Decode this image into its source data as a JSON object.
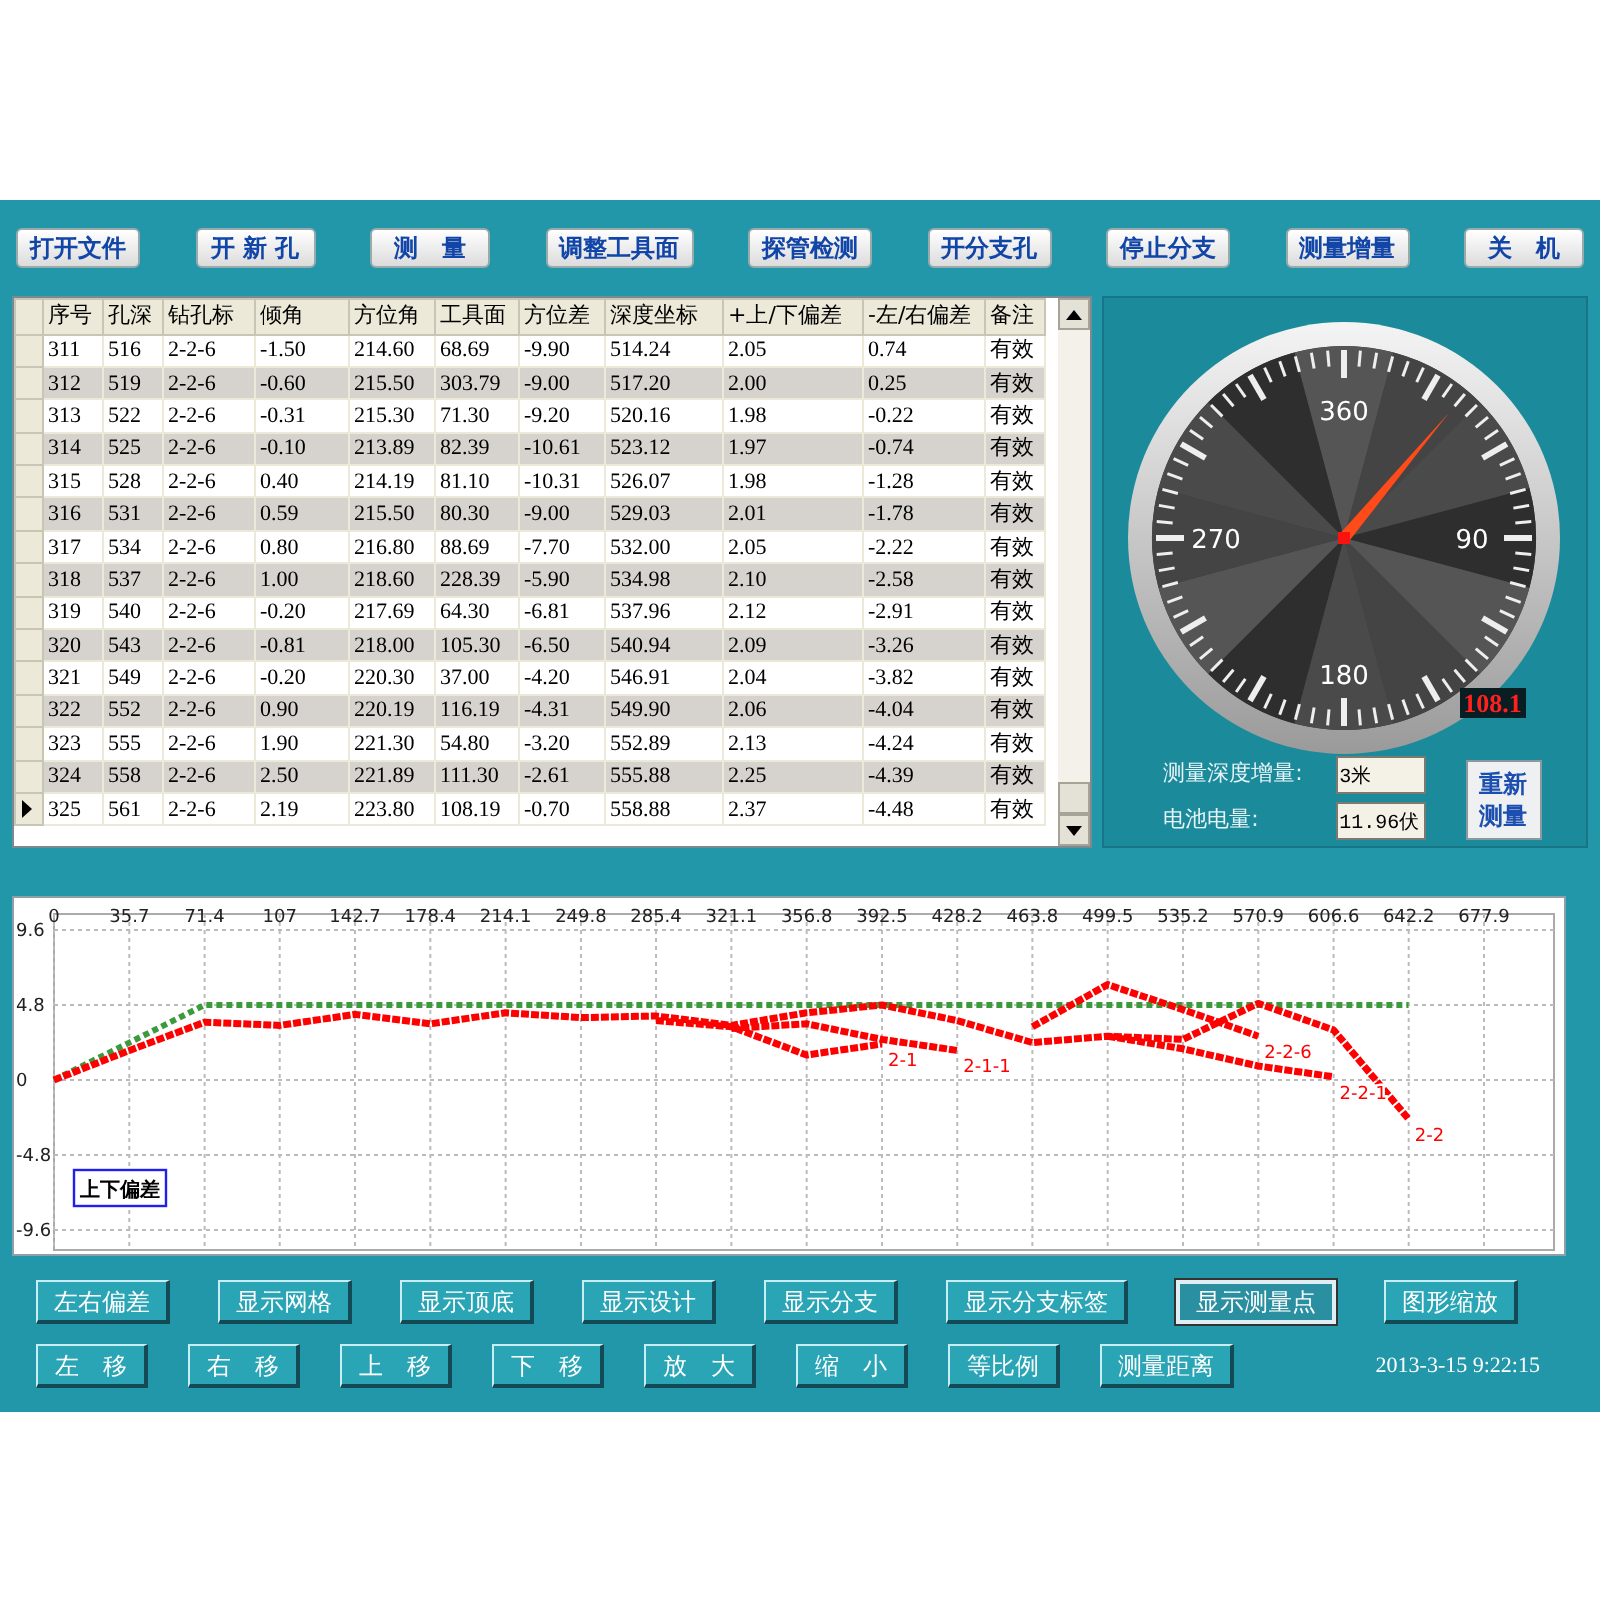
{
  "toolbar": [
    {
      "label": "打开文件"
    },
    {
      "label": "开 新 孔"
    },
    {
      "label": "测　量"
    },
    {
      "label": "调整工具面"
    },
    {
      "label": "探管检测"
    },
    {
      "label": "开分支孔"
    },
    {
      "label": "停止分支"
    },
    {
      "label": "测量增量"
    },
    {
      "label": "关　机"
    }
  ],
  "table": {
    "columns": [
      "序号",
      "孔深",
      "钻孔标",
      "倾角",
      "方位角",
      "工具面",
      "方位差",
      "深度坐标",
      "+上/下偏差",
      "-左/右偏差",
      "备注"
    ],
    "rows": [
      {
        "selected": false,
        "cells": [
          "311",
          "516",
          "2-2-6",
          "-1.50",
          "214.60",
          "68.69",
          "-9.90",
          "514.24",
          "2.05",
          "0.74",
          "有效"
        ]
      },
      {
        "selected": false,
        "cells": [
          "312",
          "519",
          "2-2-6",
          "-0.60",
          "215.50",
          "303.79",
          "-9.00",
          "517.20",
          "2.00",
          "0.25",
          "有效"
        ]
      },
      {
        "selected": false,
        "cells": [
          "313",
          "522",
          "2-2-6",
          "-0.31",
          "215.30",
          "71.30",
          "-9.20",
          "520.16",
          "1.98",
          "-0.22",
          "有效"
        ]
      },
      {
        "selected": false,
        "cells": [
          "314",
          "525",
          "2-2-6",
          "-0.10",
          "213.89",
          "82.39",
          "-10.61",
          "523.12",
          "1.97",
          "-0.74",
          "有效"
        ]
      },
      {
        "selected": false,
        "cells": [
          "315",
          "528",
          "2-2-6",
          "0.40",
          "214.19",
          "81.10",
          "-10.31",
          "526.07",
          "1.98",
          "-1.28",
          "有效"
        ]
      },
      {
        "selected": false,
        "cells": [
          "316",
          "531",
          "2-2-6",
          "0.59",
          "215.50",
          "80.30",
          "-9.00",
          "529.03",
          "2.01",
          "-1.78",
          "有效"
        ]
      },
      {
        "selected": false,
        "cells": [
          "317",
          "534",
          "2-2-6",
          "0.80",
          "216.80",
          "88.69",
          "-7.70",
          "532.00",
          "2.05",
          "-2.22",
          "有效"
        ]
      },
      {
        "selected": false,
        "cells": [
          "318",
          "537",
          "2-2-6",
          "1.00",
          "218.60",
          "228.39",
          "-5.90",
          "534.98",
          "2.10",
          "-2.58",
          "有效"
        ]
      },
      {
        "selected": false,
        "cells": [
          "319",
          "540",
          "2-2-6",
          "-0.20",
          "217.69",
          "64.30",
          "-6.81",
          "537.96",
          "2.12",
          "-2.91",
          "有效"
        ]
      },
      {
        "selected": false,
        "cells": [
          "320",
          "543",
          "2-2-6",
          "-0.81",
          "218.00",
          "105.30",
          "-6.50",
          "540.94",
          "2.09",
          "-3.26",
          "有效"
        ]
      },
      {
        "selected": false,
        "cells": [
          "321",
          "549",
          "2-2-6",
          "-0.20",
          "220.30",
          "37.00",
          "-4.20",
          "546.91",
          "2.04",
          "-3.82",
          "有效"
        ]
      },
      {
        "selected": false,
        "cells": [
          "322",
          "552",
          "2-2-6",
          "0.90",
          "220.19",
          "116.19",
          "-4.31",
          "549.90",
          "2.06",
          "-4.04",
          "有效"
        ]
      },
      {
        "selected": false,
        "cells": [
          "323",
          "555",
          "2-2-6",
          "1.90",
          "221.30",
          "54.80",
          "-3.20",
          "552.89",
          "2.13",
          "-4.24",
          "有效"
        ]
      },
      {
        "selected": false,
        "cells": [
          "324",
          "558",
          "2-2-6",
          "2.50",
          "221.89",
          "111.30",
          "-2.61",
          "555.88",
          "2.25",
          "-4.39",
          "有效"
        ]
      },
      {
        "selected": true,
        "cells": [
          "325",
          "561",
          "2-2-6",
          "2.19",
          "223.80",
          "108.19",
          "-0.70",
          "558.88",
          "2.37",
          "-4.48",
          "有效"
        ]
      }
    ]
  },
  "gauge": {
    "labels": [
      "360",
      "90",
      "180",
      "270"
    ],
    "reading": "108.1"
  },
  "fields": [
    {
      "label": "测量深度增量:",
      "value": "3米"
    },
    {
      "label": "电池电量:",
      "value": "11.96伏"
    }
  ],
  "remeasure_button": {
    "label": "重新测量"
  },
  "chart": {
    "chart_data": {
      "type": "line",
      "title": "上下偏差",
      "x": [
        0,
        35.7,
        71.4,
        107,
        142.7,
        178.4,
        214.1,
        249.8,
        285.4,
        321.1,
        356.8,
        392.5,
        428.2,
        463.8,
        499.5,
        535.2,
        570.9,
        606.6,
        642.2
      ],
      "xlim": [
        0,
        677.9
      ],
      "ylim": [
        -9.6,
        9.6
      ],
      "xticks": [
        0,
        35.7,
        71.4,
        107,
        142.7,
        178.4,
        214.1,
        249.8,
        285.4,
        321.1,
        356.8,
        392.5,
        428.2,
        463.8,
        499.5,
        535.2,
        570.9,
        606.6,
        642.2,
        677.9
      ],
      "yticks": [
        9.6,
        4.8,
        0,
        -4.8,
        -9.6
      ],
      "grid": true,
      "series": [
        {
          "color": "#3c9a3c",
          "line_style": "dashed",
          "values": [
            0,
            2.4,
            4.8,
            4.8,
            4.8,
            4.8,
            4.8,
            4.8,
            4.8,
            4.8,
            4.8,
            4.8,
            4.8,
            4.8,
            4.8,
            4.8,
            4.8,
            4.8,
            4.8
          ]
        },
        {
          "name": "2-2",
          "color": "#ff0000",
          "line_style": "dashed",
          "values": [
            0,
            1.9,
            3.7,
            3.5,
            4.2,
            3.6,
            4.3,
            4.0,
            4.1,
            3.5,
            4.3,
            4.8,
            3.8,
            2.4,
            2.8,
            2.6,
            4.9,
            3.2,
            -2.5
          ]
        },
        {
          "name": "2-1",
          "color": "#ff0000",
          "line_style": "dashed",
          "values": [
            null,
            null,
            null,
            null,
            null,
            null,
            null,
            null,
            3.8,
            3.4,
            1.6,
            2.3,
            null,
            null,
            null,
            null,
            null,
            null,
            null
          ]
        },
        {
          "name": "2-1-1",
          "color": "#ff0000",
          "line_style": "dashed",
          "values": [
            null,
            null,
            null,
            null,
            null,
            null,
            null,
            null,
            null,
            3.3,
            3.6,
            2.6,
            1.9,
            null,
            null,
            null,
            null,
            null,
            null
          ]
        },
        {
          "name": "2-2-6",
          "color": "#ff0000",
          "line_style": "dashed",
          "values": [
            null,
            null,
            null,
            null,
            null,
            null,
            null,
            null,
            null,
            null,
            null,
            null,
            null,
            3.4,
            6.1,
            4.5,
            2.8,
            null,
            null
          ]
        },
        {
          "name": "2-2-1",
          "color": "#ff0000",
          "line_style": "dashed",
          "values": [
            null,
            null,
            null,
            null,
            null,
            null,
            null,
            null,
            null,
            null,
            null,
            null,
            null,
            null,
            2.8,
            2.0,
            0.9,
            0.2,
            null
          ]
        }
      ]
    }
  },
  "bottom_buttons": [
    [
      {
        "label": "左右偏差",
        "selected": false
      },
      {
        "label": "显示网格",
        "selected": false
      },
      {
        "label": "显示顶底",
        "selected": false
      },
      {
        "label": "显示设计",
        "selected": false
      },
      {
        "label": "显示分支",
        "selected": false
      },
      {
        "label": "显示分支标签",
        "selected": false
      },
      {
        "label": "显示测量点",
        "selected": true
      },
      {
        "label": "图形缩放",
        "selected": false
      }
    ],
    [
      {
        "label": "左　移",
        "selected": false
      },
      {
        "label": "右　移",
        "selected": false
      },
      {
        "label": "上　移",
        "selected": false
      },
      {
        "label": "下　移",
        "selected": false
      },
      {
        "label": "放　大",
        "selected": false
      },
      {
        "label": "缩　小",
        "selected": false
      },
      {
        "label": "等比例",
        "selected": false
      },
      {
        "label": "测量距离",
        "selected": false
      }
    ]
  ],
  "status_time": "2013-3-15 9:22:15"
}
